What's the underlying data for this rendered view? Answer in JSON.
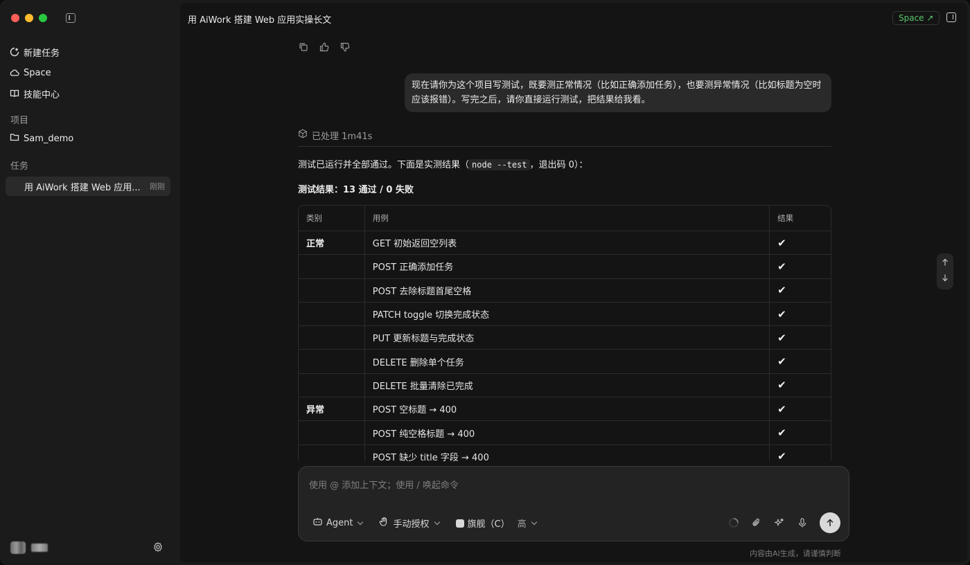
{
  "sidebar": {
    "nav": [
      {
        "label": "新建任务",
        "icon": "new-task-icon"
      },
      {
        "label": "Space",
        "icon": "cloud-icon"
      },
      {
        "label": "技能中心",
        "icon": "book-icon"
      }
    ],
    "projects_label": "项目",
    "project": {
      "label": "Sam_demo",
      "icon": "folder-icon"
    },
    "tasks_label": "任务",
    "task": {
      "title": "用 AiWork 搭建 Web 应用...",
      "time": "刚刚"
    }
  },
  "header": {
    "title": "用 AiWork 搭建 Web 应用实操长文",
    "space_button": "Space ↗"
  },
  "conversation": {
    "user_message": "现在请你为这个项目写测试，既要测正常情况（比如正确添加任务），也要测异常情况（比如标题为空时应该报错）。写完之后，请你直接运行测试，把结果给我看。",
    "processed": "已处理 1m41s",
    "summary_before": "测试已运行并全部通过。下面是实测结果（",
    "summary_code": "node --test",
    "summary_after": "，退出码 0）：",
    "result_heading": "测试结果：13 通过 / 0 失败",
    "table": {
      "headers": [
        "类别",
        "用例",
        "结果"
      ],
      "rows": [
        {
          "category": "正常",
          "case": "GET 初始返回空列表",
          "result": "✔"
        },
        {
          "category": "",
          "case": "POST 正确添加任务",
          "result": "✔"
        },
        {
          "category": "",
          "case": "POST 去除标题首尾空格",
          "result": "✔"
        },
        {
          "category": "",
          "case": "PATCH toggle 切换完成状态",
          "result": "✔"
        },
        {
          "category": "",
          "case": "PUT 更新标题与完成状态",
          "result": "✔"
        },
        {
          "category": "",
          "case": "DELETE 删除单个任务",
          "result": "✔"
        },
        {
          "category": "",
          "case": "DELETE 批量清除已完成",
          "result": "✔"
        },
        {
          "category": "异常",
          "case": "POST 空标题 → 400",
          "result": "✔"
        },
        {
          "category": "",
          "case": "POST 纯空格标题 → 400",
          "result": "✔"
        },
        {
          "category": "",
          "case": "POST 缺少 title 字段 → 400",
          "result": "✔"
        }
      ]
    }
  },
  "composer": {
    "placeholder": "使用 @ 添加上下文；使用 / 唤起命令",
    "mode": "Agent",
    "permission": "手动授权",
    "model": "旗舰（C）",
    "level": "高"
  },
  "footer": {
    "disclaimer": "内容由AI生成，请谨慎判断"
  },
  "colors": {
    "accent_green": "#5bc96a",
    "traffic_red": "#fe5f57",
    "traffic_yellow": "#febc2e",
    "traffic_green": "#28c840"
  }
}
